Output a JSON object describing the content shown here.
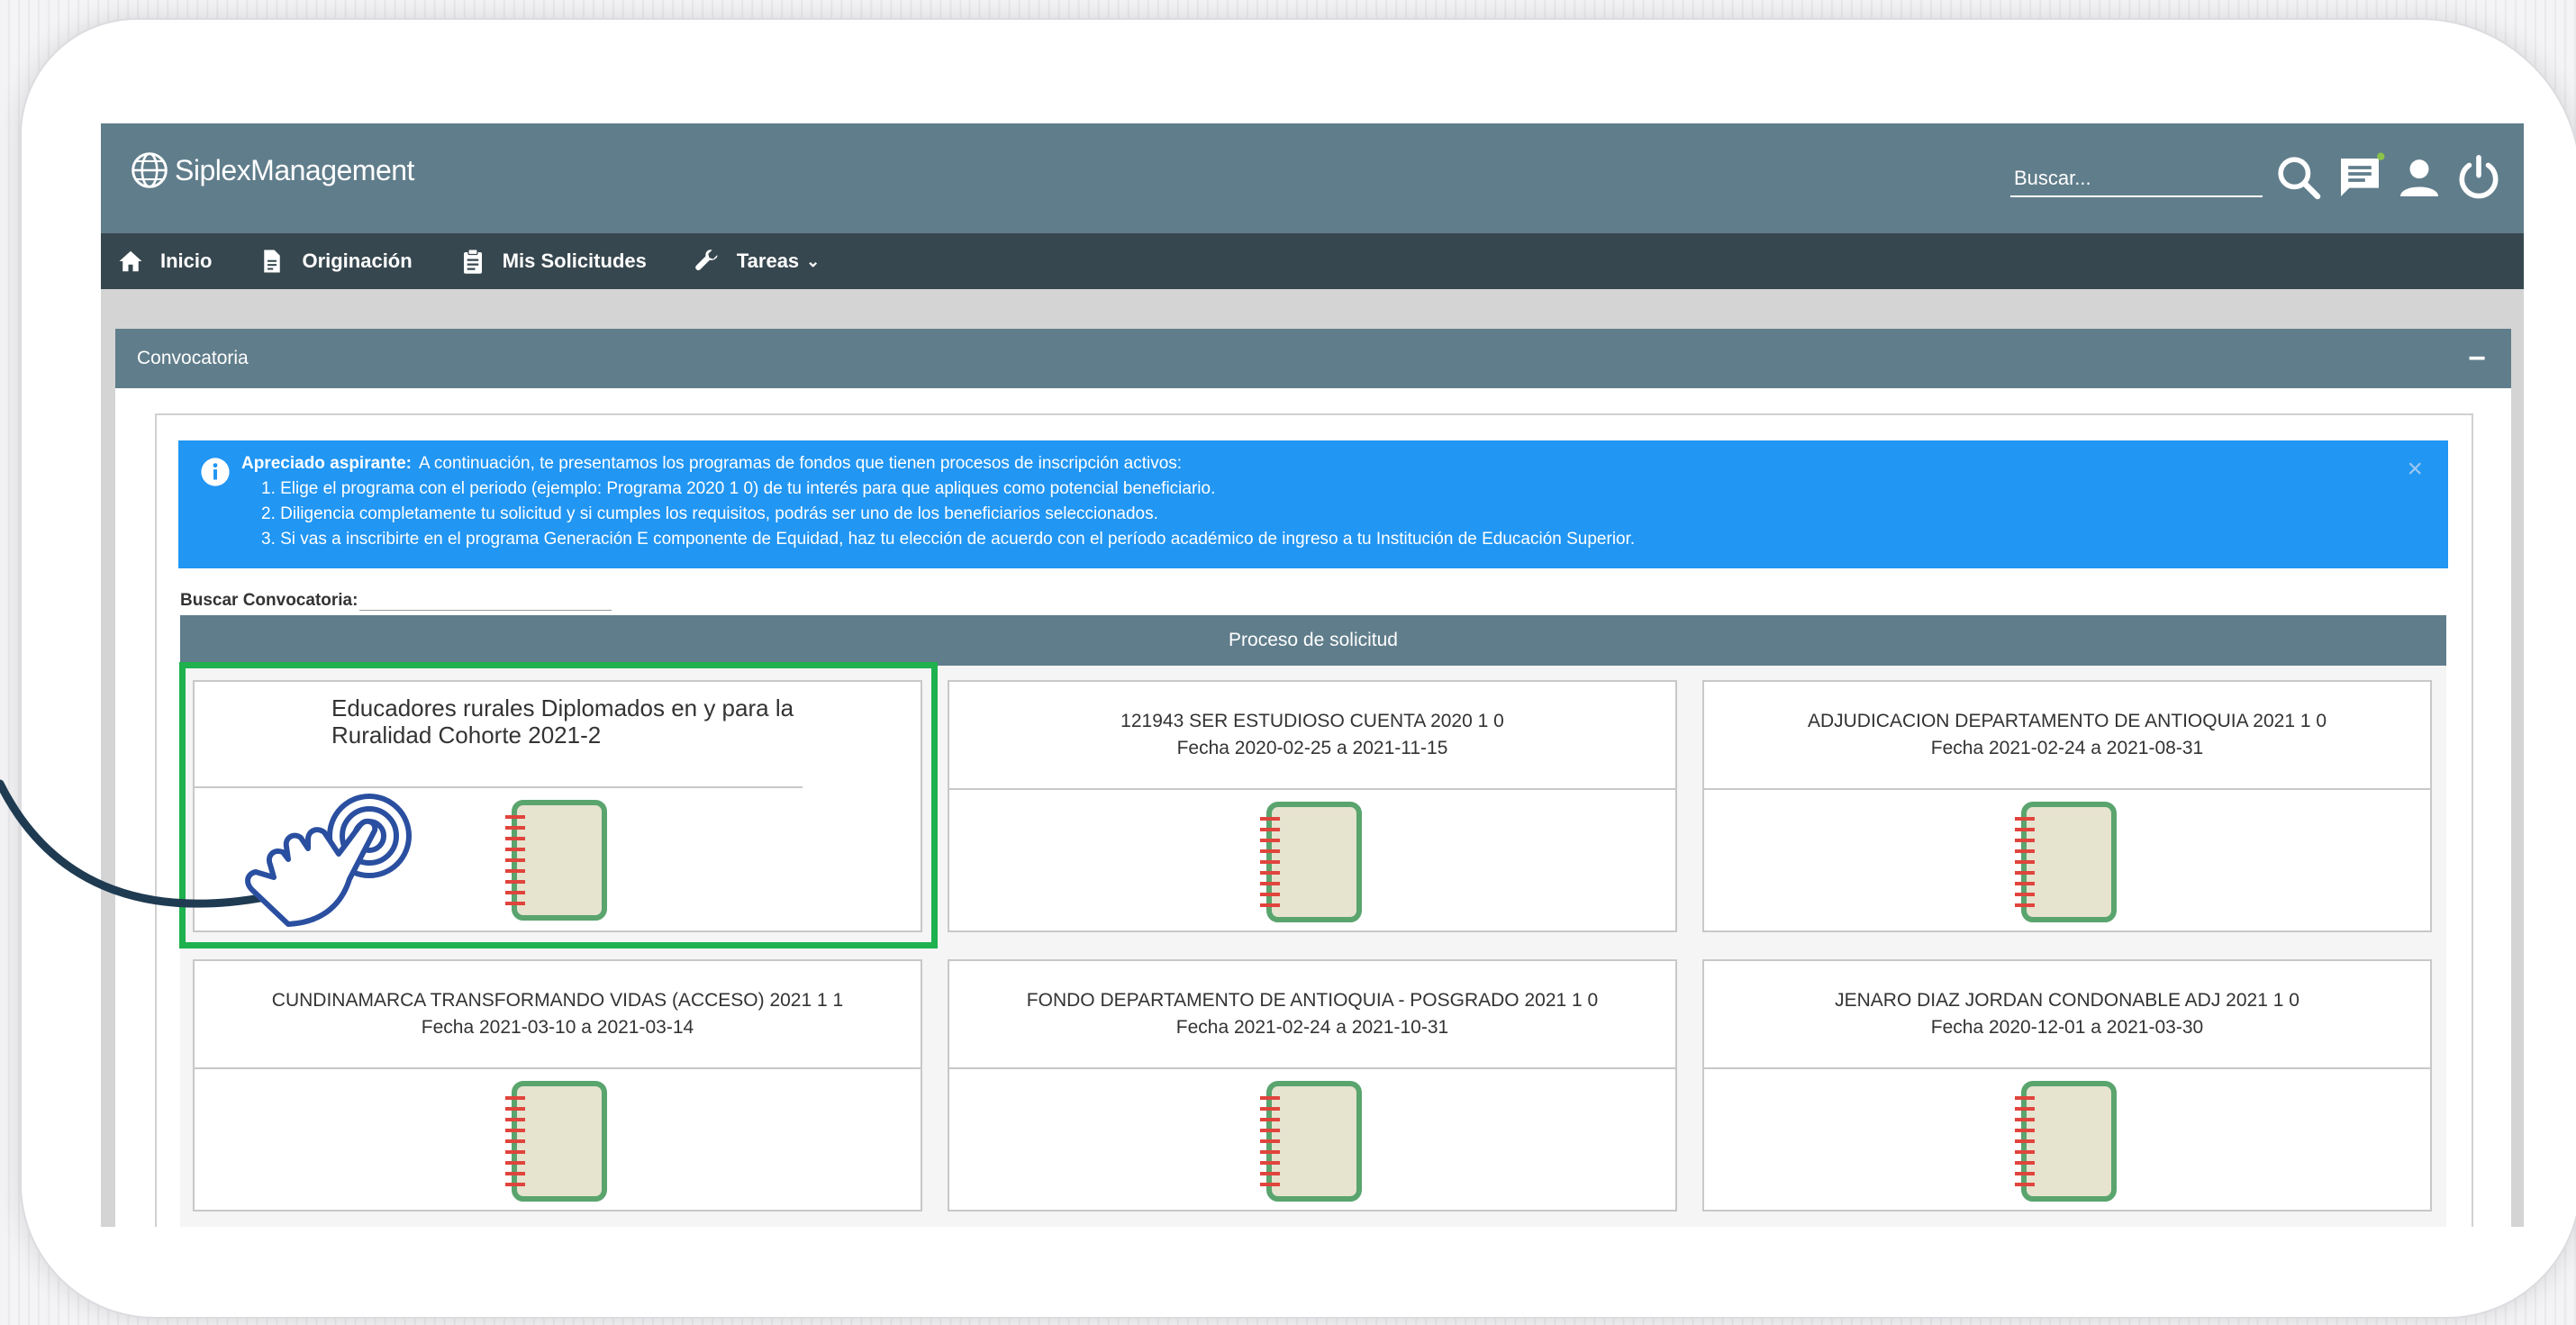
{
  "app": {
    "name": "SiplexManagement"
  },
  "search": {
    "placeholder": "Buscar..."
  },
  "nav": {
    "items": [
      {
        "label": "Inicio",
        "icon": "home-icon"
      },
      {
        "label": "Originación",
        "icon": "document-icon"
      },
      {
        "label": "Mis Solicitudes",
        "icon": "clipboard-icon"
      },
      {
        "label": "Tareas",
        "icon": "wrench-icon"
      }
    ]
  },
  "panel": {
    "title": "Convocatoria",
    "toggle": "−"
  },
  "alert": {
    "lead_bold": "Apreciado aspirante:",
    "lead_text": "A continuación, te presentamos los programas de fondos que tienen procesos de inscripción activos:",
    "lines": [
      "1. Elige el programa con el periodo (ejemplo: Programa 2020 1 0) de tu interés para que apliques como potencial beneficiario.",
      "2. Diligencia completamente tu solicitud y si cumples los requisitos, podrás ser uno de los beneficiarios seleccionados.",
      "3. Si vas a inscribirte en el programa Generación E componente de Equidad, haz tu elección de acuerdo con el período académico de ingreso a tu Institución de Educación Superior."
    ],
    "close": "×"
  },
  "search_conv": {
    "label": "Buscar Convocatoria:"
  },
  "table": {
    "header": "Proceso de solicitud"
  },
  "cards": [
    {
      "title": "Educadores rurales Diplomados en y para la Ruralidad Cohorte 2021-2",
      "date": ""
    },
    {
      "title": "121943 SER ESTUDIOSO CUENTA 2020 1 0",
      "date": "Fecha 2020-02-25 a 2021-11-15"
    },
    {
      "title": "ADJUDICACION DEPARTAMENTO DE ANTIOQUIA 2021 1 0",
      "date": "Fecha 2021-02-24 a 2021-08-31"
    },
    {
      "title": "CUNDINAMARCA TRANSFORMANDO VIDAS (ACCESO) 2021 1 1",
      "date": "Fecha 2021-03-10 a 2021-03-14"
    },
    {
      "title": "FONDO DEPARTAMENTO DE ANTIOQUIA - POSGRADO 2021 1 0",
      "date": "Fecha 2021-02-24 a 2021-10-31"
    },
    {
      "title": "JENARO DIAZ JORDAN CONDONABLE ADJ 2021 1 0",
      "date": "Fecha 2020-12-01 a 2021-03-30"
    }
  ],
  "colors": {
    "topbar": "#607d8b",
    "navbar": "#37474f",
    "alert": "#2196f3",
    "highlight": "#1fb14e",
    "hand": "#2a4fa0"
  }
}
